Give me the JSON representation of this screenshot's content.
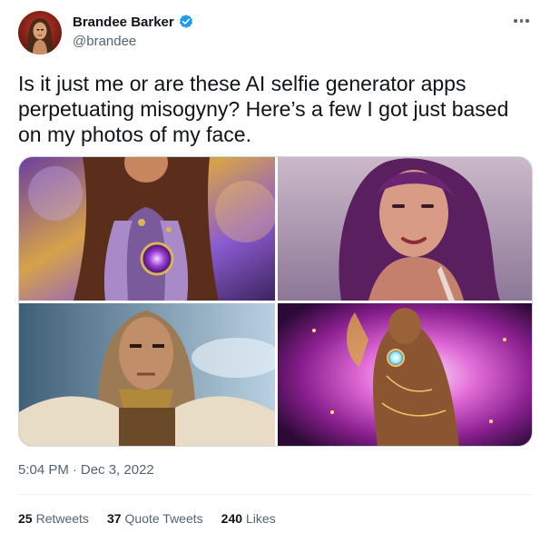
{
  "author": {
    "display_name": "Brandee Barker",
    "handle": "@brandee",
    "verified": true,
    "verified_color": "#1d9bf0"
  },
  "more_icon": "more-horizontal-icon",
  "tweet": {
    "text": "Is it just me or are these AI selfie generator apps perpetuating misogyny? Here’s a few I got just based on my photos of my face."
  },
  "media": [
    {
      "kind": "ai-portrait",
      "palette": "purple-gold-armor"
    },
    {
      "kind": "ai-portrait",
      "palette": "violet-dusk"
    },
    {
      "kind": "ai-portrait",
      "palette": "warrior-fur-sky"
    },
    {
      "kind": "ai-portrait",
      "palette": "magenta-cosmic"
    }
  ],
  "meta": {
    "time": "5:04 PM",
    "separator": "·",
    "date": "Dec 3, 2022"
  },
  "stats": {
    "retweets_count": "25",
    "retweets_label": "Retweets",
    "quotes_count": "37",
    "quotes_label": "Quote Tweets",
    "likes_count": "240",
    "likes_label": "Likes"
  }
}
